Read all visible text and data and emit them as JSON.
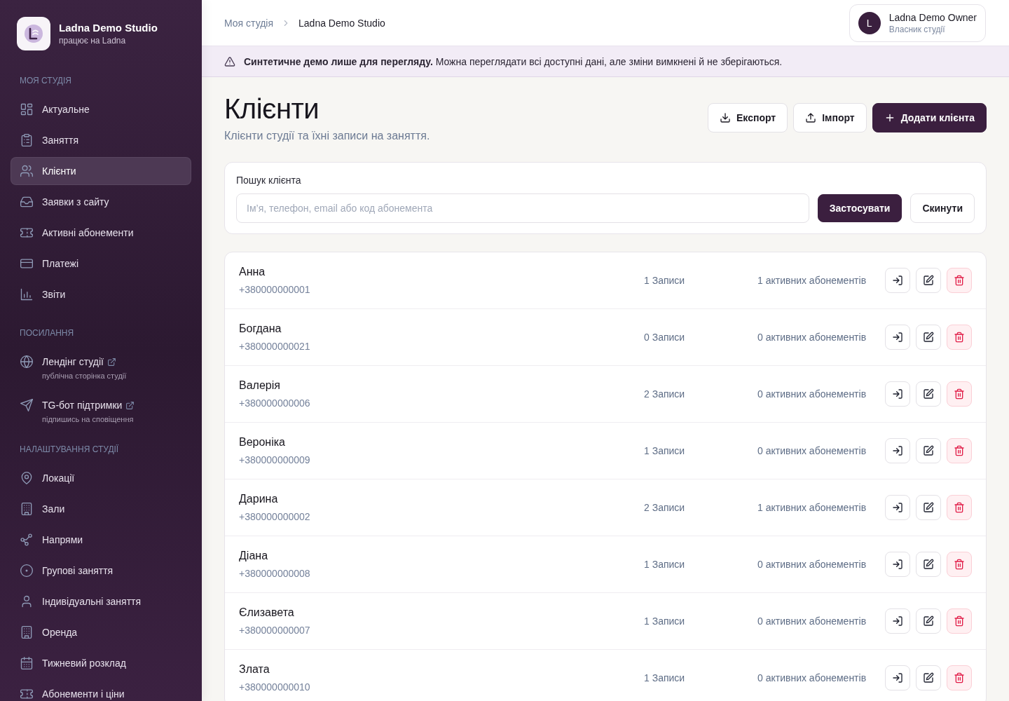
{
  "sidebar": {
    "studio": {
      "name": "Ladna Demo Studio",
      "subtitle": "працює на Ladna"
    },
    "sections": [
      {
        "title": "МОЯ СТУДІЯ",
        "items": [
          {
            "kind": "page",
            "label": "Актуальне",
            "selected": false
          },
          {
            "kind": "page",
            "label": "Заняття",
            "selected": false
          },
          {
            "kind": "page",
            "label": "Клієнти",
            "selected": true
          },
          {
            "kind": "page",
            "label": "Заявки з сайту",
            "selected": false
          },
          {
            "kind": "page",
            "label": "Активні абонементи",
            "selected": false
          },
          {
            "kind": "page",
            "label": "Платежі",
            "selected": false
          },
          {
            "kind": "page",
            "label": "Звіти",
            "selected": false
          }
        ]
      },
      {
        "title": "ПОСИЛАННЯ",
        "items": [
          {
            "kind": "external",
            "label": "Лендінг студії",
            "hint": "публічна сторінка студії"
          },
          {
            "kind": "external",
            "label": "TG-бот підтримки",
            "hint": "підпишись на сповіщення"
          }
        ]
      },
      {
        "title": "НАЛАШТУВАННЯ СТУДІЇ",
        "items": [
          {
            "kind": "page",
            "label": "Локації",
            "selected": false
          },
          {
            "kind": "page",
            "label": "Зали",
            "selected": false
          },
          {
            "kind": "page",
            "label": "Напрями",
            "selected": false
          },
          {
            "kind": "page",
            "label": "Групові заняття",
            "selected": false
          },
          {
            "kind": "page",
            "label": "Індивідуальні заняття",
            "selected": false
          },
          {
            "kind": "page",
            "label": "Оренда",
            "selected": false
          },
          {
            "kind": "page",
            "label": "Тижневий розклад",
            "selected": false
          },
          {
            "kind": "page",
            "label": "Абонементи і ціни",
            "selected": false
          }
        ]
      }
    ]
  },
  "top_bar": {
    "breadcrumb": [
      "Моя студія",
      "Ladna Demo Studio"
    ],
    "user": {
      "initial": "L",
      "name": "Ladna Demo Owner",
      "role": "Власник студії"
    }
  },
  "banner": {
    "text": "**Синтетичне демо лише для перегляду.** Можна переглядати всі доступні дані, але зміни вимкнені й не зберігаються."
  },
  "page": {
    "title": "Клієнти",
    "subtitle": "Клієнти студії та їхні записи на заняття.",
    "actions": [
      {
        "label": "Експорт",
        "kind": "outline"
      },
      {
        "label": "Імпорт",
        "kind": "outline"
      },
      {
        "label": "Додати клієнта",
        "kind": "filled"
      }
    ]
  },
  "search": {
    "label": "Пошук клієнта",
    "placeholder": "Ім’я, телефон, email або код абонемента",
    "buttons": [
      {
        "label": "Застосувати",
        "kind": "filled"
      },
      {
        "label": "Скинути",
        "kind": "outline"
      }
    ]
  },
  "clients": [
    {
      "name": "Анна",
      "phone": "+380000000001",
      "bookings": "1 Записи",
      "subscriptions": "1 активних абонементів"
    },
    {
      "name": "Богдана",
      "phone": "+380000000021",
      "bookings": "0 Записи",
      "subscriptions": "0 активних абонементів"
    },
    {
      "name": "Валерія",
      "phone": "+380000000006",
      "bookings": "2 Записи",
      "subscriptions": "0 активних абонементів"
    },
    {
      "name": "Вероніка",
      "phone": "+380000000009",
      "bookings": "1 Записи",
      "subscriptions": "0 активних абонементів"
    },
    {
      "name": "Дарина",
      "phone": "+380000000002",
      "bookings": "2 Записи",
      "subscriptions": "1 активних абонементів"
    },
    {
      "name": "Діана",
      "phone": "+380000000008",
      "bookings": "1 Записи",
      "subscriptions": "0 активних абонементів"
    },
    {
      "name": "Єлизавета",
      "phone": "+380000000007",
      "bookings": "1 Записи",
      "subscriptions": "0 активних абонементів"
    },
    {
      "name": "Злата",
      "phone": "+380000000010",
      "bookings": "1 Записи",
      "subscriptions": "0 активних абонементів"
    }
  ]
}
